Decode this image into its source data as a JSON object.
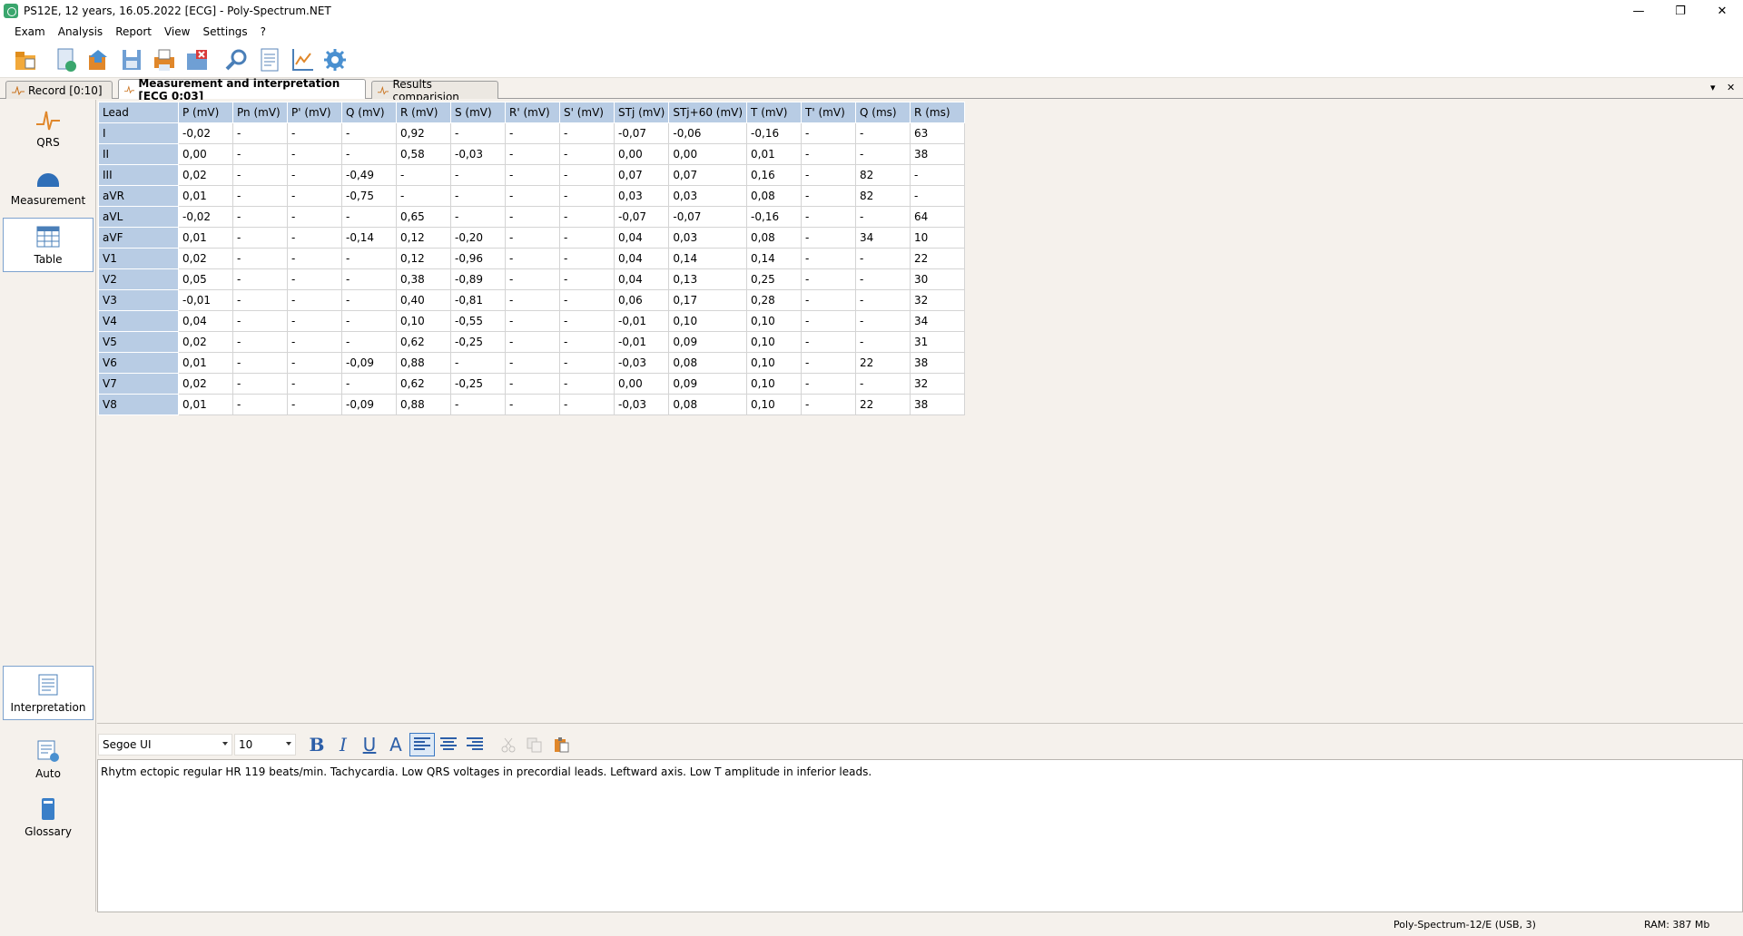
{
  "window": {
    "title": "PS12E, 12 years, 16.05.2022 [ECG] - Poly-Spectrum.NET",
    "minimize": "—",
    "restore": "❐",
    "close": "✕"
  },
  "menu": [
    "Exam",
    "Analysis",
    "Report",
    "View",
    "Settings",
    "?"
  ],
  "toolbar": {
    "buttons": [
      "open-exam-icon",
      "record-icon",
      "export-icon",
      "save-icon",
      "print-icon",
      "close-exam-icon",
      "measure-tool-icon",
      "report-icon",
      "chart-icon",
      "settings-gear-icon"
    ]
  },
  "tabs": [
    {
      "label": "Record [0:10]"
    },
    {
      "label": "Measurement and interpretation [ECG 0:03]"
    },
    {
      "label": "Results comparision"
    }
  ],
  "tab_controls": {
    "dropdown": "▾",
    "close": "✕"
  },
  "sidebar": {
    "items": [
      {
        "label": "QRS",
        "icon": "qrs-wave-icon"
      },
      {
        "label": "Measurement",
        "icon": "measurement-icon"
      },
      {
        "label": "Table",
        "icon": "table-icon"
      },
      {
        "label": "Interpretation",
        "icon": "interpretation-icon"
      },
      {
        "label": "Auto",
        "icon": "auto-icon"
      },
      {
        "label": "Glossary",
        "icon": "glossary-book-icon"
      }
    ]
  },
  "table": {
    "headers": [
      "Lead",
      "P (mV)",
      "Pn (mV)",
      "P' (mV)",
      "Q (mV)",
      "R (mV)",
      "S (mV)",
      "R' (mV)",
      "S' (mV)",
      "STj (mV)",
      "STj+60 (mV)",
      "T (mV)",
      "T' (mV)",
      "Q (ms)",
      "R (ms)"
    ],
    "rows": [
      [
        "I",
        "-0,02",
        "-",
        "-",
        "-",
        "0,92",
        "-",
        "-",
        "-",
        "-0,07",
        "-0,06",
        "-0,16",
        "-",
        "-",
        "63"
      ],
      [
        "II",
        "0,00",
        "-",
        "-",
        "-",
        "0,58",
        "-0,03",
        "-",
        "-",
        "0,00",
        "0,00",
        "0,01",
        "-",
        "-",
        "38"
      ],
      [
        "III",
        "0,02",
        "-",
        "-",
        "-0,49",
        "-",
        "-",
        "-",
        "-",
        "0,07",
        "0,07",
        "0,16",
        "-",
        "82",
        "-"
      ],
      [
        "aVR",
        "0,01",
        "-",
        "-",
        "-0,75",
        "-",
        "-",
        "-",
        "-",
        "0,03",
        "0,03",
        "0,08",
        "-",
        "82",
        "-"
      ],
      [
        "aVL",
        "-0,02",
        "-",
        "-",
        "-",
        "0,65",
        "-",
        "-",
        "-",
        "-0,07",
        "-0,07",
        "-0,16",
        "-",
        "-",
        "64"
      ],
      [
        "aVF",
        "0,01",
        "-",
        "-",
        "-0,14",
        "0,12",
        "-0,20",
        "-",
        "-",
        "0,04",
        "0,03",
        "0,08",
        "-",
        "34",
        "10"
      ],
      [
        "V1",
        "0,02",
        "-",
        "-",
        "-",
        "0,12",
        "-0,96",
        "-",
        "-",
        "0,04",
        "0,14",
        "0,14",
        "-",
        "-",
        "22"
      ],
      [
        "V2",
        "0,05",
        "-",
        "-",
        "-",
        "0,38",
        "-0,89",
        "-",
        "-",
        "0,04",
        "0,13",
        "0,25",
        "-",
        "-",
        "30"
      ],
      [
        "V3",
        "-0,01",
        "-",
        "-",
        "-",
        "0,40",
        "-0,81",
        "-",
        "-",
        "0,06",
        "0,17",
        "0,28",
        "-",
        "-",
        "32"
      ],
      [
        "V4",
        "0,04",
        "-",
        "-",
        "-",
        "0,10",
        "-0,55",
        "-",
        "-",
        "-0,01",
        "0,10",
        "0,10",
        "-",
        "-",
        "34"
      ],
      [
        "V5",
        "0,02",
        "-",
        "-",
        "-",
        "0,62",
        "-0,25",
        "-",
        "-",
        "-0,01",
        "0,09",
        "0,10",
        "-",
        "-",
        "31"
      ],
      [
        "V6",
        "0,01",
        "-",
        "-",
        "-0,09",
        "0,88",
        "-",
        "-",
        "-",
        "-0,03",
        "0,08",
        "0,10",
        "-",
        "22",
        "38"
      ],
      [
        "V7",
        "0,02",
        "-",
        "-",
        "-",
        "0,62",
        "-0,25",
        "-",
        "-",
        "0,00",
        "0,09",
        "0,10",
        "-",
        "-",
        "32"
      ],
      [
        "V8",
        "0,01",
        "-",
        "-",
        "-0,09",
        "0,88",
        "-",
        "-",
        "-",
        "-0,03",
        "0,08",
        "0,10",
        "-",
        "22",
        "38"
      ]
    ]
  },
  "format_bar": {
    "font": "Segoe UI",
    "size": "10",
    "bold": "B",
    "italic": "I",
    "underline": "U",
    "color": "A"
  },
  "interpretation_text": "Rhytm ectopic regular HR 119 beats/min. Tachycardia. Low QRS voltages in precordial leads. Leftward axis. Low T amplitude in inferior leads.",
  "status": {
    "device": "Poly-Spectrum-12/E (USB, 3)",
    "ram": "RAM: 387 Mb"
  }
}
